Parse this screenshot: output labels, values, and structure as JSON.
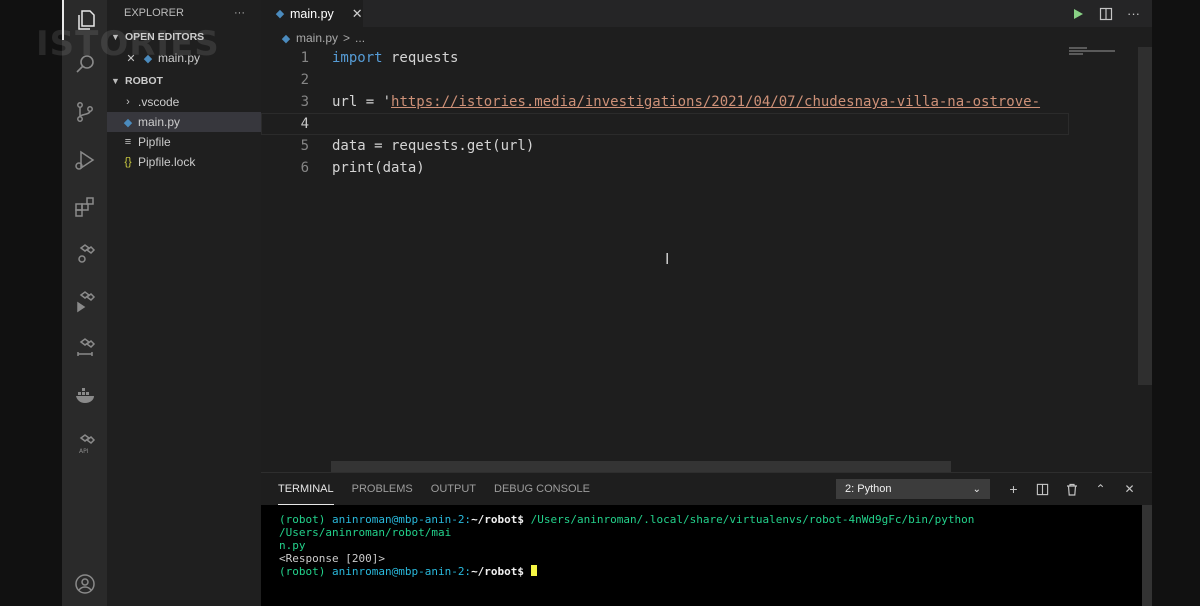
{
  "watermark": "ISTORIES",
  "explorer": {
    "title": "EXPLORER",
    "more": "···",
    "open_editors_label": "OPEN EDITORS",
    "open_editor_file": "main.py",
    "folder_label": "ROBOT",
    "items": [
      {
        "name": ".vscode",
        "icon": "chevron-right-icon"
      },
      {
        "name": "main.py",
        "icon": "python-file-icon"
      },
      {
        "name": "Pipfile",
        "icon": "file-icon"
      },
      {
        "name": "Pipfile.lock",
        "icon": "json-braces-icon"
      }
    ]
  },
  "editor": {
    "tab_label": "main.py",
    "breadcrumb_file": "main.py",
    "breadcrumb_sep": ">",
    "breadcrumb_more": "...",
    "lines": [
      {
        "num": "1",
        "text": "import requests"
      },
      {
        "num": "2",
        "text": ""
      },
      {
        "num": "3",
        "text": "url = 'https://istories.media/investigations/2021/04/07/chudesnaya-villa-na-ostrove-"
      },
      {
        "num": "4",
        "text": ""
      },
      {
        "num": "5",
        "text": "data = requests.get(url)"
      },
      {
        "num": "6",
        "text": "print(data)"
      }
    ],
    "code_parts": {
      "kw_import": "import",
      "rest1": " requests",
      "url_prefix": "url = '",
      "url_value": "https://istories.media/investigations/2021/04/07/chudesnaya-villa-na-ostrove-",
      "line5": "data = requests.get(url)",
      "line6": "print(data)"
    }
  },
  "panel": {
    "tabs": [
      "TERMINAL",
      "PROBLEMS",
      "OUTPUT",
      "DEBUG CONSOLE"
    ],
    "terminal_select": "2: Python",
    "terminal": {
      "prompt_env": "(robot)",
      "prompt_user": "aninroman@mbp-anin-2:",
      "prompt_path": "~/robot$",
      "command": "/Users/aninroman/.local/share/virtualenvs/robot-4nWd9gFc/bin/python /Users/aninroman/robot/mai",
      "command_wrap": "n.py",
      "output": "<Response [200]>"
    }
  },
  "colors": {
    "accent_keyword": "#569cd6",
    "string": "#ce9178",
    "terminal_green": "#23d18b",
    "terminal_cyan": "#29b8db",
    "run_green": "#89d185"
  }
}
